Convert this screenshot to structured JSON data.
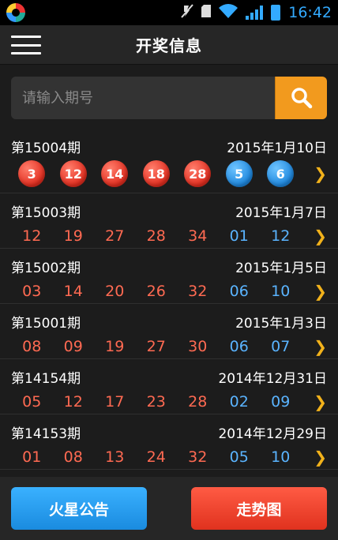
{
  "status": {
    "time": "16:42"
  },
  "header": {
    "title": "开奖信息"
  },
  "search": {
    "placeholder": "请输入期号"
  },
  "draws": [
    {
      "period": "第15004期",
      "date": "2015年1月10日",
      "red": [
        "3",
        "12",
        "14",
        "18",
        "28"
      ],
      "blue": [
        "5",
        "6"
      ]
    },
    {
      "period": "第15003期",
      "date": "2015年1月7日",
      "red": [
        "12",
        "19",
        "27",
        "28",
        "34"
      ],
      "blue": [
        "01",
        "12"
      ]
    },
    {
      "period": "第15002期",
      "date": "2015年1月5日",
      "red": [
        "03",
        "14",
        "20",
        "26",
        "32"
      ],
      "blue": [
        "06",
        "10"
      ]
    },
    {
      "period": "第15001期",
      "date": "2015年1月3日",
      "red": [
        "08",
        "09",
        "19",
        "27",
        "30"
      ],
      "blue": [
        "06",
        "07"
      ]
    },
    {
      "period": "第14154期",
      "date": "2014年12月31日",
      "red": [
        "05",
        "12",
        "17",
        "23",
        "28"
      ],
      "blue": [
        "02",
        "09"
      ]
    },
    {
      "period": "第14153期",
      "date": "2014年12月29日",
      "red": [
        "01",
        "08",
        "13",
        "24",
        "32"
      ],
      "blue": [
        "05",
        "10"
      ]
    }
  ],
  "footer": {
    "left_label": "火星公告",
    "right_label": "走势图"
  },
  "colors": {
    "accent_orange": "#f29a1e",
    "red_ball": "#e22d1f",
    "blue_ball": "#1d86dd",
    "chevron": "#f2b21b"
  }
}
